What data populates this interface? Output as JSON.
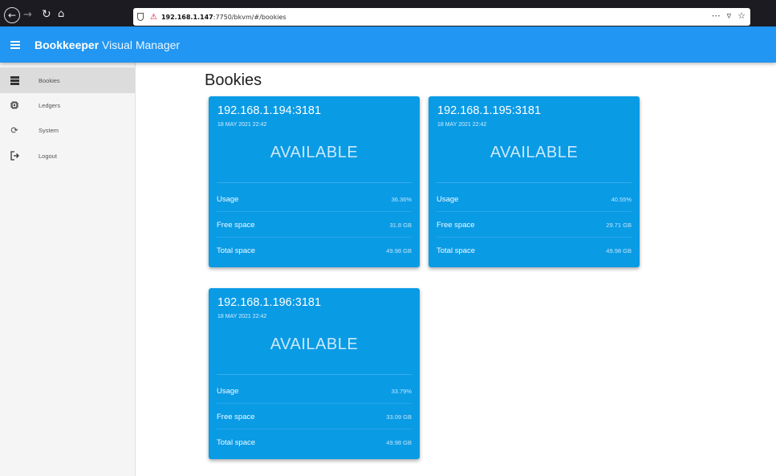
{
  "browser": {
    "url_host": "192.168.1.147",
    "url_rest": ":7750/bkvm/#/bookies",
    "actions": [
      "⋯",
      "▿",
      "☆"
    ]
  },
  "app": {
    "title_bold": "Bookkeeper",
    "title_rest": " Visual Manager",
    "accent": "#2196f3",
    "card_color": "#0a9be5"
  },
  "sidebar": {
    "items": [
      {
        "label": "Bookies",
        "icon": "server-icon",
        "active": true
      },
      {
        "label": "Ledgers",
        "icon": "chip-icon",
        "active": false
      },
      {
        "label": "System",
        "icon": "sync-icon",
        "active": false
      },
      {
        "label": "Logout",
        "icon": "logout-icon",
        "active": false
      }
    ]
  },
  "page": {
    "title": "Bookies"
  },
  "bookies": [
    {
      "host": "192.168.1.194:3181",
      "date": "18 MAY 2021 22:42",
      "status": "AVAILABLE",
      "rows": [
        {
          "label": "Usage",
          "value": "36.36%"
        },
        {
          "label": "Free space",
          "value": "31.8 GB"
        },
        {
          "label": "Total space",
          "value": "49.98 GB"
        }
      ]
    },
    {
      "host": "192.168.1.195:3181",
      "date": "18 MAY 2021 22:42",
      "status": "AVAILABLE",
      "rows": [
        {
          "label": "Usage",
          "value": "40.55%"
        },
        {
          "label": "Free space",
          "value": "29.71 GB"
        },
        {
          "label": "Total space",
          "value": "49.98 GB"
        }
      ]
    },
    {
      "host": "192.168.1.196:3181",
      "date": "18 MAY 2021 22:42",
      "status": "AVAILABLE",
      "rows": [
        {
          "label": "Usage",
          "value": "33.79%"
        },
        {
          "label": "Free space",
          "value": "33.09 GB"
        },
        {
          "label": "Total space",
          "value": "49.98 GB"
        }
      ]
    }
  ]
}
